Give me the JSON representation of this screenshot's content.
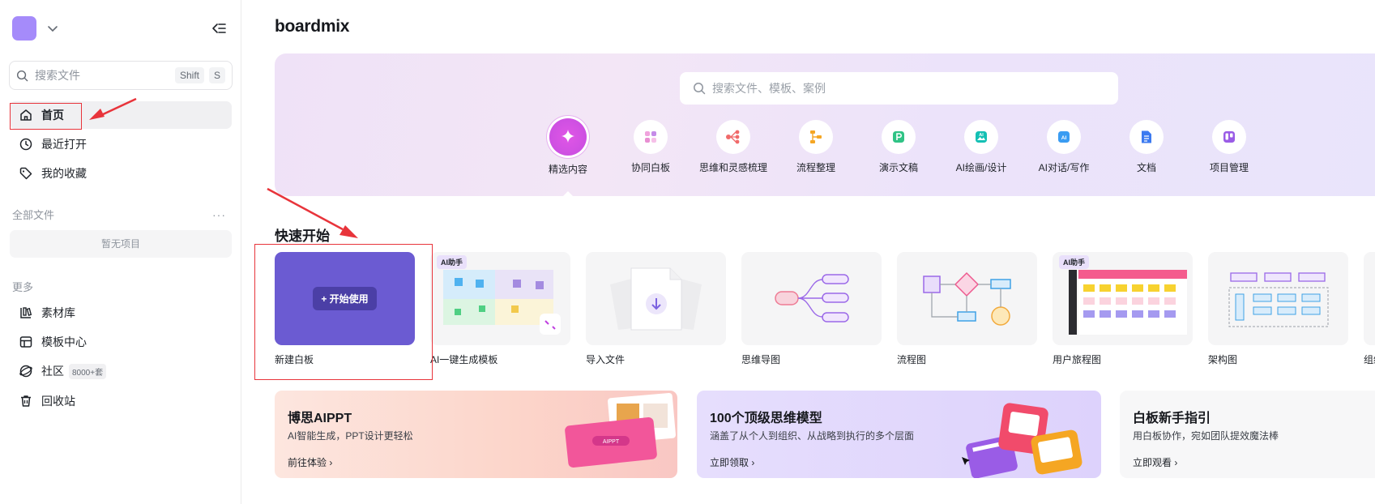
{
  "sidebar": {
    "search_placeholder": "搜索文件",
    "shortcut_keys": [
      "Shift",
      "S"
    ],
    "nav": [
      {
        "label": "首页",
        "icon": "home-icon"
      },
      {
        "label": "最近打开",
        "icon": "clock-icon"
      },
      {
        "label": "我的收藏",
        "icon": "tag-icon"
      }
    ],
    "all_files_label": "全部文件",
    "all_files_more": "···",
    "empty_label": "暂无项目",
    "more_label": "更多",
    "more_items": [
      {
        "label": "素材库",
        "icon": "library-icon"
      },
      {
        "label": "模板中心",
        "icon": "template-icon"
      },
      {
        "label": "社区",
        "icon": "community-icon",
        "badge": "8000+套"
      },
      {
        "label": "回收站",
        "icon": "trash-icon"
      }
    ]
  },
  "main": {
    "logo": "boardmix",
    "hero_search_placeholder": "搜索文件、模板、案例",
    "categories": [
      {
        "label": "精选内容",
        "icon": "sparkle-icon",
        "selected": true
      },
      {
        "label": "协同白板",
        "icon": "whiteboard-icon"
      },
      {
        "label": "思维和灵感梳理",
        "icon": "mindmap-icon"
      },
      {
        "label": "流程整理",
        "icon": "flow-icon"
      },
      {
        "label": "演示文稿",
        "icon": "presentation-icon"
      },
      {
        "label": "AI绘画/设计",
        "icon": "ai-image-icon"
      },
      {
        "label": "AI对话/写作",
        "icon": "ai-chat-icon"
      },
      {
        "label": "文档",
        "icon": "document-icon"
      },
      {
        "label": "项目管理",
        "icon": "kanban-icon"
      }
    ],
    "quick_start_title": "快速开始",
    "start_button": "+ 开始使用",
    "ai_tag": "AI助手",
    "cards": [
      {
        "label": "新建白板"
      },
      {
        "label": "AI一键生成模板"
      },
      {
        "label": "导入文件"
      },
      {
        "label": "思维导图"
      },
      {
        "label": "流程图"
      },
      {
        "label": "用户旅程图"
      },
      {
        "label": "架构图"
      },
      {
        "label": "组织"
      }
    ],
    "banners": [
      {
        "title": "博思AIPPT",
        "subtitle": "AI智能生成，PPT设计更轻松",
        "link": "前往体验"
      },
      {
        "title": "100个顶级思维模型",
        "subtitle": "涵盖了从个人到组织、从战略到执行的多个层面",
        "link": "立即领取"
      },
      {
        "title": "白板新手指引",
        "subtitle": "用白板协作，宛如团队提效魔法棒",
        "link": "立即观看"
      }
    ]
  },
  "colors": {
    "accent_purple": "#6c5ccf",
    "annotation_red": "#e8343b",
    "hero_start": "#efe2f7",
    "hero_end": "#e9e4fb"
  }
}
